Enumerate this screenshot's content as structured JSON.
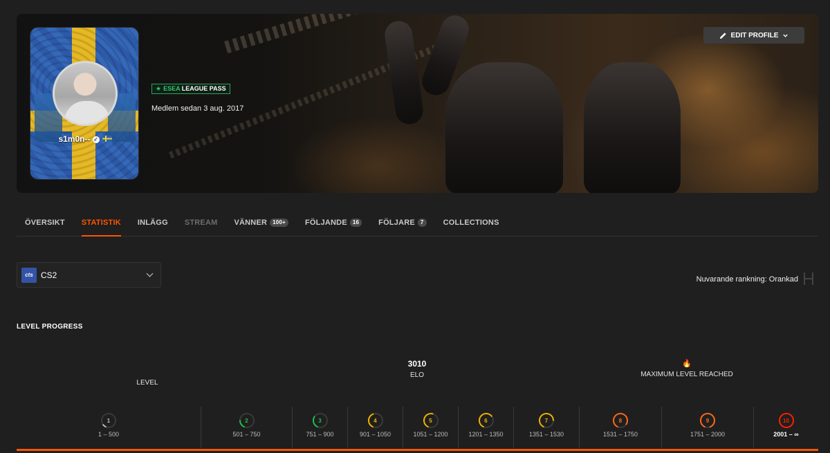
{
  "profile": {
    "nickname": "s1m0n--",
    "esea_word": "ESEA",
    "esea_rest": "LEAGUE PASS",
    "member_since": "Medlem sedan 3 aug. 2017",
    "edit_label": "EDIT PROFILE"
  },
  "tabs": [
    {
      "label": "ÖVERSIKT",
      "badge": ""
    },
    {
      "label": "STATISTIK",
      "badge": ""
    },
    {
      "label": "INLÄGG",
      "badge": ""
    },
    {
      "label": "STREAM",
      "badge": ""
    },
    {
      "label": "VÄNNER",
      "badge": "100+"
    },
    {
      "label": "FÖLJANDE",
      "badge": "16"
    },
    {
      "label": "FÖLJARE",
      "badge": "7"
    },
    {
      "label": "COLLECTIONS",
      "badge": ""
    }
  ],
  "game": {
    "icon_text": "cts",
    "name": "CS2"
  },
  "ranking": "Nuvarande rankning: Orankad",
  "level_progress": {
    "title": "LEVEL PROGRESS",
    "level_label": "LEVEL",
    "elo_value": "3010",
    "elo_label": "ELO",
    "max_label": "MAXIMUM LEVEL REACHED"
  },
  "levels": [
    {
      "level": "1",
      "range": "1 – 500",
      "color": "#bdbdbd"
    },
    {
      "level": "2",
      "range": "501 – 750",
      "color": "#1ec24b"
    },
    {
      "level": "3",
      "range": "751 – 900",
      "color": "#1ec24b"
    },
    {
      "level": "4",
      "range": "901 – 1050",
      "color": "#f0b400"
    },
    {
      "level": "5",
      "range": "1051 – 1200",
      "color": "#f0b400"
    },
    {
      "level": "6",
      "range": "1201 – 1350",
      "color": "#f0b400"
    },
    {
      "level": "7",
      "range": "1351 – 1530",
      "color": "#f0b400"
    },
    {
      "level": "8",
      "range": "1531 – 1750",
      "color": "#ff6a1a"
    },
    {
      "level": "9",
      "range": "1751 – 2000",
      "color": "#ff6a1a"
    },
    {
      "level": "10",
      "range": "2001 – ∞",
      "color": "#fe1f00"
    }
  ],
  "current_level_index": 9,
  "accent_color": "#ff5500"
}
